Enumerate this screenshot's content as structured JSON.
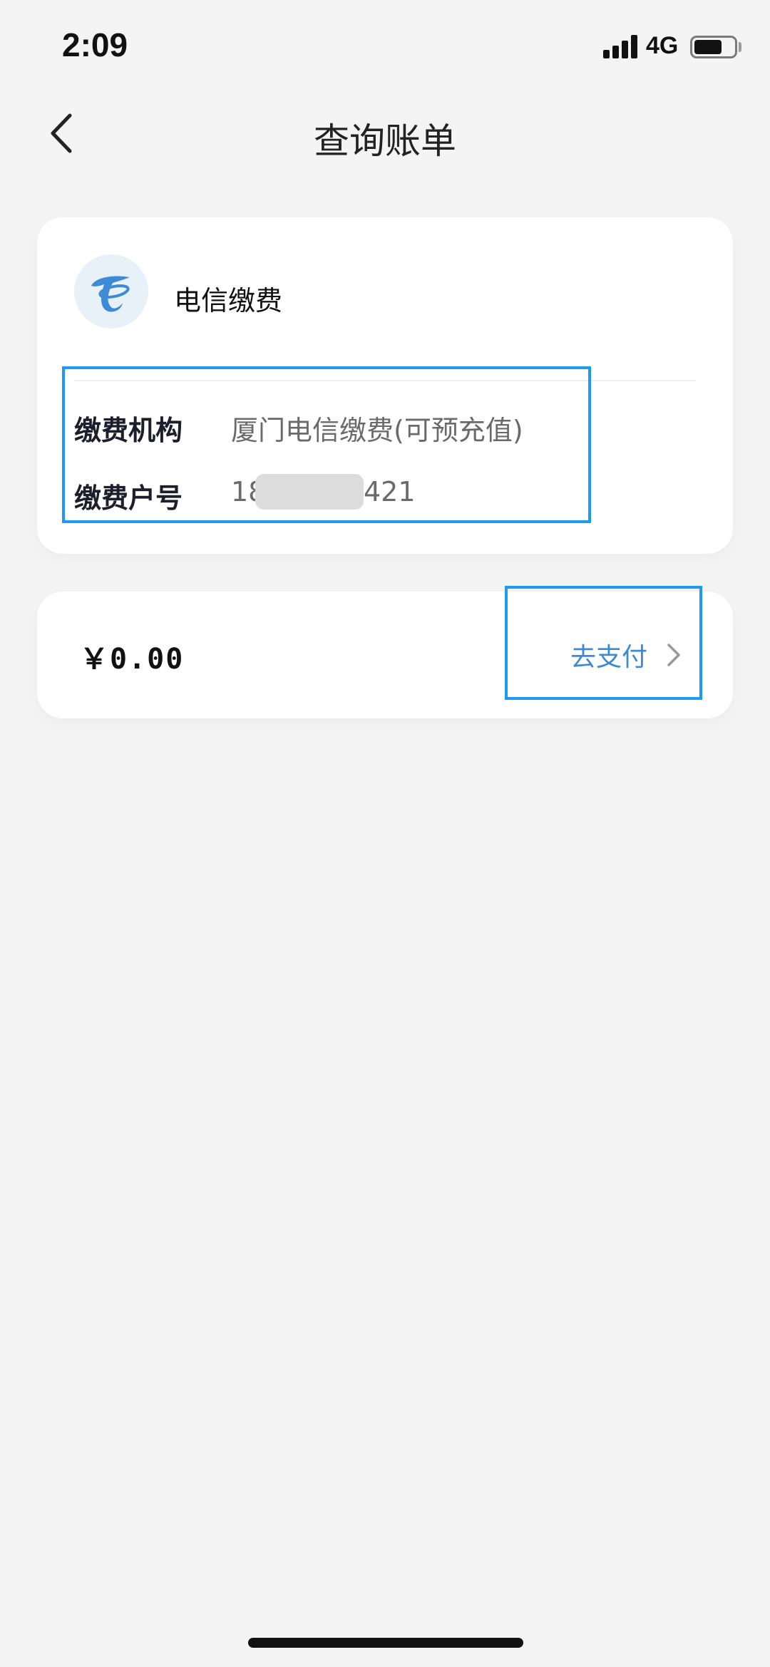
{
  "status_bar": {
    "time": "2:09",
    "network": "4G"
  },
  "nav": {
    "title": "查询账单"
  },
  "service": {
    "name": "电信缴费",
    "logo_icon": "china-telecom-logo"
  },
  "info": {
    "institution_label": "缴费机构",
    "institution_value": "厦门电信缴费(可预充值)",
    "account_label": "缴费户号",
    "account_prefix": "18",
    "account_suffix": "421"
  },
  "payment": {
    "amount": "￥0.00",
    "pay_label": "去支付"
  },
  "colors": {
    "background": "#f4f4f4",
    "card": "#ffffff",
    "accent": "#3a8ad4",
    "highlight": "#1e9bf0",
    "logo": "#3d8bd6"
  }
}
